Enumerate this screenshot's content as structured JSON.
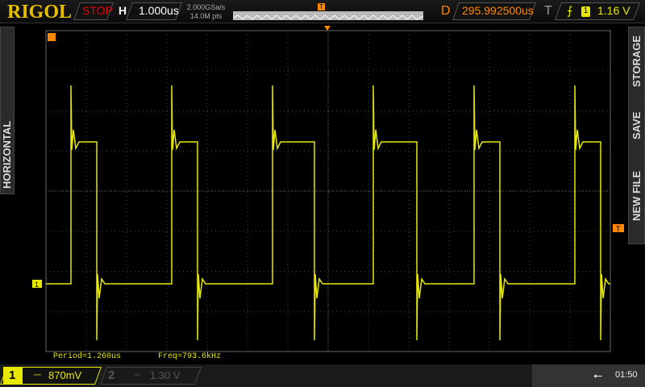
{
  "header": {
    "logo": "RIGOL",
    "run_status": "STOP",
    "h_label": "H",
    "timebase": "1.000us",
    "sample_rate": "2.000GSa/s",
    "memory_depth": "14.0M pts",
    "delay_label": "D",
    "delay": "295.992500us",
    "trigger_label": "T",
    "trigger_channel": "1",
    "trigger_level": "1.16 V"
  },
  "side_left": {
    "horizontal": "HORIZONTAL"
  },
  "side_right": {
    "storage": "STORAGE",
    "save": "SAVE",
    "new_file": "NEW FILE"
  },
  "measurements": {
    "period": "Period=1.260us",
    "freq": "Freq=793.6kHz"
  },
  "channels": [
    {
      "num": "1",
      "coupling": "⎓",
      "scale": "870mV",
      "color": "#e8e800"
    },
    {
      "num": "2",
      "coupling": "⎓",
      "scale": "1.30 V",
      "color": "#555555"
    }
  ],
  "status": {
    "usb": "usb-icon",
    "time": "01:50"
  },
  "markers": {
    "trigger": "T",
    "ch1": "1"
  }
}
